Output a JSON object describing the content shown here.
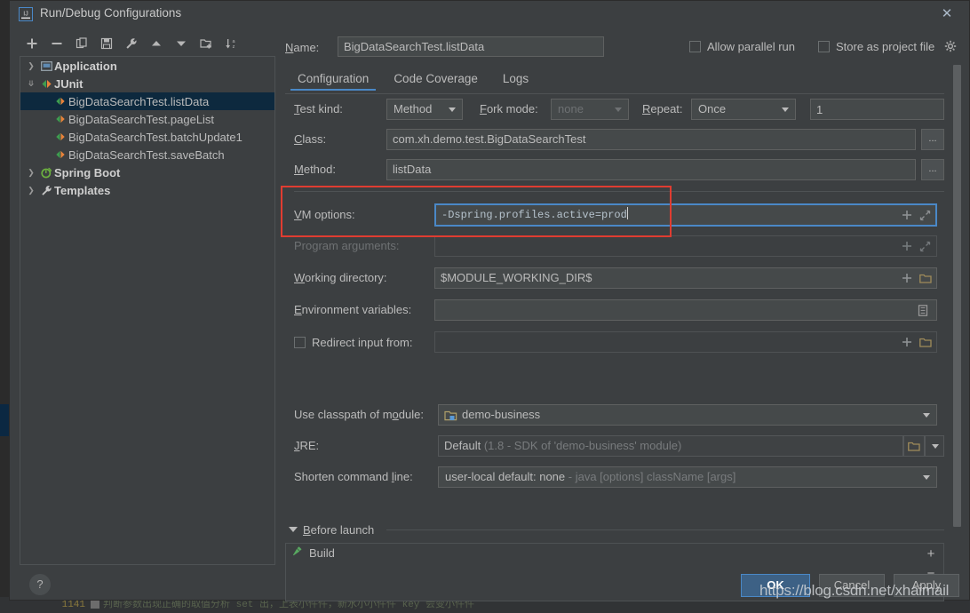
{
  "window": {
    "title": "Run/Debug Configurations",
    "app_icon": "intellij-idea-icon",
    "close_label": "✕"
  },
  "toolbar": {
    "buttons": [
      {
        "name": "add-configuration-button",
        "icon": "plus-icon",
        "label": "+"
      },
      {
        "name": "remove-configuration-button",
        "icon": "minus-icon",
        "label": "−"
      },
      {
        "name": "copy-configuration-button",
        "icon": "copy-icon",
        "label": "Copy"
      },
      {
        "name": "save-configuration-button",
        "icon": "save-icon",
        "label": "Save"
      },
      {
        "name": "edit-defaults-button",
        "icon": "wrench-icon",
        "label": "Edit defaults"
      },
      {
        "name": "move-up-button",
        "icon": "arrow-up-icon",
        "label": "Move up"
      },
      {
        "name": "move-down-button",
        "icon": "arrow-down-icon",
        "label": "Move down"
      },
      {
        "name": "new-folder-button",
        "icon": "new-folder-icon",
        "label": "New folder"
      },
      {
        "name": "sort-configurations-button",
        "icon": "sort-az-icon",
        "label": "Sort"
      }
    ]
  },
  "tree": {
    "items": [
      {
        "label": "Application",
        "icon": "application-icon",
        "expander": "chevron-right-icon",
        "level": 0,
        "group": true,
        "selected": false
      },
      {
        "label": "JUnit",
        "icon": "junit-icon",
        "expander": "chevron-down-icon",
        "level": 0,
        "group": true,
        "selected": false
      },
      {
        "label": "BigDataSearchTest.listData",
        "icon": "junit-run-icon",
        "expander": "",
        "level": 1,
        "group": false,
        "selected": true
      },
      {
        "label": "BigDataSearchTest.pageList",
        "icon": "junit-run-icon",
        "expander": "",
        "level": 1,
        "group": false,
        "selected": false
      },
      {
        "label": "BigDataSearchTest.batchUpdate1",
        "icon": "junit-run-icon",
        "expander": "",
        "level": 1,
        "group": false,
        "selected": false
      },
      {
        "label": "BigDataSearchTest.saveBatch",
        "icon": "junit-run-icon",
        "expander": "",
        "level": 1,
        "group": false,
        "selected": false
      },
      {
        "label": "Spring Boot",
        "icon": "spring-boot-icon",
        "expander": "chevron-right-icon",
        "level": 0,
        "group": true,
        "selected": false
      },
      {
        "label": "Templates",
        "icon": "wrench-icon",
        "expander": "chevron-right-icon",
        "level": 0,
        "group": true,
        "selected": false
      }
    ]
  },
  "header": {
    "name_label": "Name:",
    "name_value": "BigDataSearchTest.listData",
    "allow_parallel_run_label": "Allow parallel run",
    "allow_parallel_run_checked": false,
    "store_as_project_file_label": "Store as project file",
    "store_as_project_file_checked": false,
    "gear_icon": "gear-icon"
  },
  "tabs": [
    {
      "label": "Configuration",
      "active": true
    },
    {
      "label": "Code Coverage",
      "active": false
    },
    {
      "label": "Logs",
      "active": false
    }
  ],
  "form": {
    "test_kind_label": "Test kind:",
    "test_kind_value": "Method",
    "fork_mode_label": "Fork mode:",
    "fork_mode_value": "none",
    "repeat_label": "Repeat:",
    "repeat_value": "Once",
    "repeat_count_value": "1",
    "class_label": "Class:",
    "class_value": "com.xh.demo.test.BigDataSearchTest",
    "class_browse_label": "...",
    "method_label": "Method:",
    "method_value": "listData",
    "method_browse_label": "...",
    "vm_options_label": "VM options:",
    "vm_options_value": "-Dspring.profiles.active=prod",
    "program_arguments_label": "Program arguments:",
    "program_arguments_value": "",
    "working_directory_label": "Working directory:",
    "working_directory_value": "$MODULE_WORKING_DIR$",
    "environment_variables_label": "Environment variables:",
    "environment_variables_value": "",
    "redirect_input_label": "Redirect input from:",
    "redirect_input_checked": false,
    "redirect_input_value": "",
    "use_classpath_label": "Use classpath of module:",
    "use_classpath_value": "demo-business",
    "jre_label": "JRE:",
    "jre_value": "Default",
    "jre_value_sub": "(1.8 - SDK of 'demo-business' module)",
    "shorten_command_line_label": "Shorten command line:",
    "shorten_command_line_value": "user-local default: none",
    "shorten_command_line_sub": "- java [options] className [args]",
    "expand_icon": "expand-icon",
    "insert_macro_icon": "plus-icon",
    "browse_folder_icon": "folder-icon",
    "env_editor_icon": "list-editor-icon"
  },
  "before_launch": {
    "title": "Before launch",
    "collapse_icon": "triangle-down-icon",
    "items": [
      {
        "label": "Build",
        "icon": "build-hammer-icon"
      }
    ],
    "add_label": "+",
    "remove_label": "−",
    "edit_icon": "pencil-icon"
  },
  "footer": {
    "help_label": "?",
    "ok_label": "OK",
    "cancel_label": "Cancel",
    "apply_label": "Apply"
  },
  "annotation": {
    "highlight_color": "#e03c31",
    "focus_color": "#4a88c7"
  },
  "watermark": {
    "text": "https://blog.csdn.net/xhaimail"
  },
  "background_editor": {
    "line_number": "1141",
    "code_fragment": "判断参数出现正确的取值分析  set 出，上表小件件，新水小小件件 key 会变小件件"
  }
}
